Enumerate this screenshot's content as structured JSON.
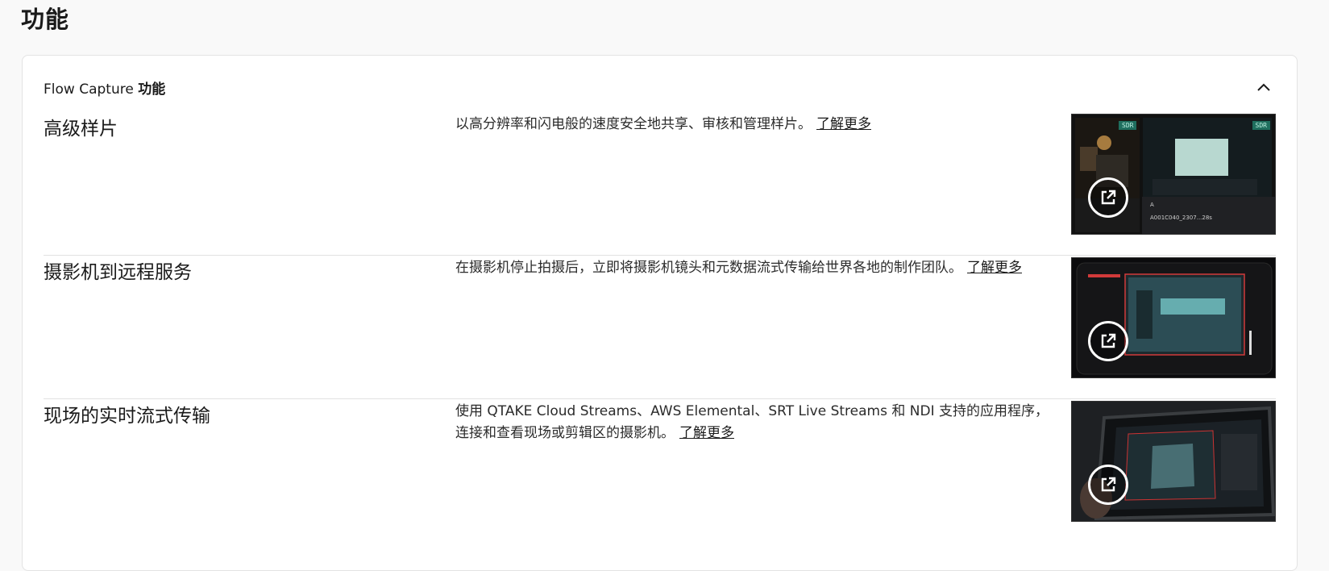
{
  "page": {
    "title": "功能"
  },
  "section": {
    "title_prefix": "Flow Capture ",
    "title_bold": "功能",
    "collapse_icon": "chevron-up-icon"
  },
  "features": [
    {
      "name": "高级样片",
      "description": "以高分辨率和闪电般的速度安全地共享、审核和管理样片。",
      "link": "了解更多",
      "thumb": {
        "badge1": "SDR",
        "badge2": "SDR",
        "clip_letter": "A",
        "clip_name": "A001C040_2307...28s",
        "icon": "external-link-icon"
      }
    },
    {
      "name": "摄影机到远程服务",
      "description": "在摄影机停止拍摄后，立即将摄影机镜头和元数据流式传输给世界各地的制作团队。",
      "link": "了解更多",
      "thumb": {
        "icon": "external-link-icon"
      }
    },
    {
      "name": "现场的实时流式传输",
      "description": "使用 QTAKE Cloud Streams、AWS Elemental、SRT Live Streams 和 NDI 支持的应用程序，连接和查看现场或剪辑区的摄影机。",
      "link": "了解更多",
      "thumb": {
        "icon": "external-link-icon"
      }
    }
  ]
}
